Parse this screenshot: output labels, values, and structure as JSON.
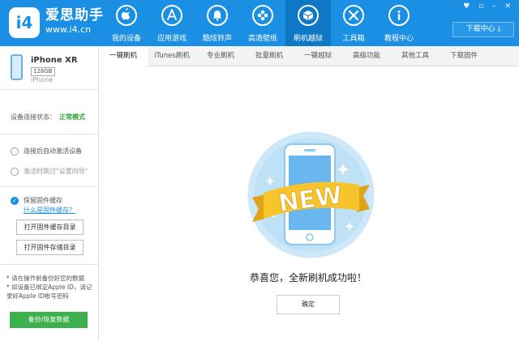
{
  "header": {
    "logo_text": "i4",
    "brand_name": "爱思助手",
    "brand_url": "www.i4.cn",
    "nav": [
      {
        "label": "我的设备",
        "icon": "apple-icon"
      },
      {
        "label": "应用游戏",
        "icon": "app-store-icon"
      },
      {
        "label": "酷炫铃声",
        "icon": "bell-icon"
      },
      {
        "label": "高清壁纸",
        "icon": "flower-icon"
      },
      {
        "label": "刷机越狱",
        "icon": "box-icon"
      },
      {
        "label": "工具箱",
        "icon": "tools-icon"
      },
      {
        "label": "教程中心",
        "icon": "info-icon"
      }
    ],
    "active_nav": "刷机越狱",
    "download_center": "下载中心",
    "window_controls": "♥ ▫ – ✕"
  },
  "device": {
    "name": "iPhone XR",
    "capacity": "128GB",
    "type": "iPhone"
  },
  "sidebar": {
    "connection_label": "设备连接状态：",
    "connection_status": "正常模式",
    "option_auto_activate": "连接后自动激活设备",
    "option_skip_setup": "激活时跳过\"设置向导\"",
    "keep_firmware": "保留固件缓存",
    "what_is_firmware": "什么是固件缓存？",
    "open_firmware_cache": "打开固件缓存目录",
    "open_firmware_storage": "打开固件存储目录",
    "note_1": "* 请在操作前备份好您的数据",
    "note_2": "* 如设备已绑定Apple ID，请记录好Apple ID帐号密码",
    "backup_button": "备份/恢复数据"
  },
  "tabs": [
    "一键刷机",
    "iTunes刷机",
    "专业刷机",
    "批量刷机",
    "一键越狱",
    "高级功能",
    "其他工具",
    "下载固件"
  ],
  "active_tab": "一键刷机",
  "main": {
    "badge_text": "NEW",
    "success_message": "恭喜您，全新刷机成功啦！",
    "confirm_button": "确定"
  },
  "colors": {
    "primary": "#1a8fe3",
    "success": "#35a43a",
    "button_green": "#3cb14b",
    "ribbon_yellow": "#f7c52b"
  }
}
